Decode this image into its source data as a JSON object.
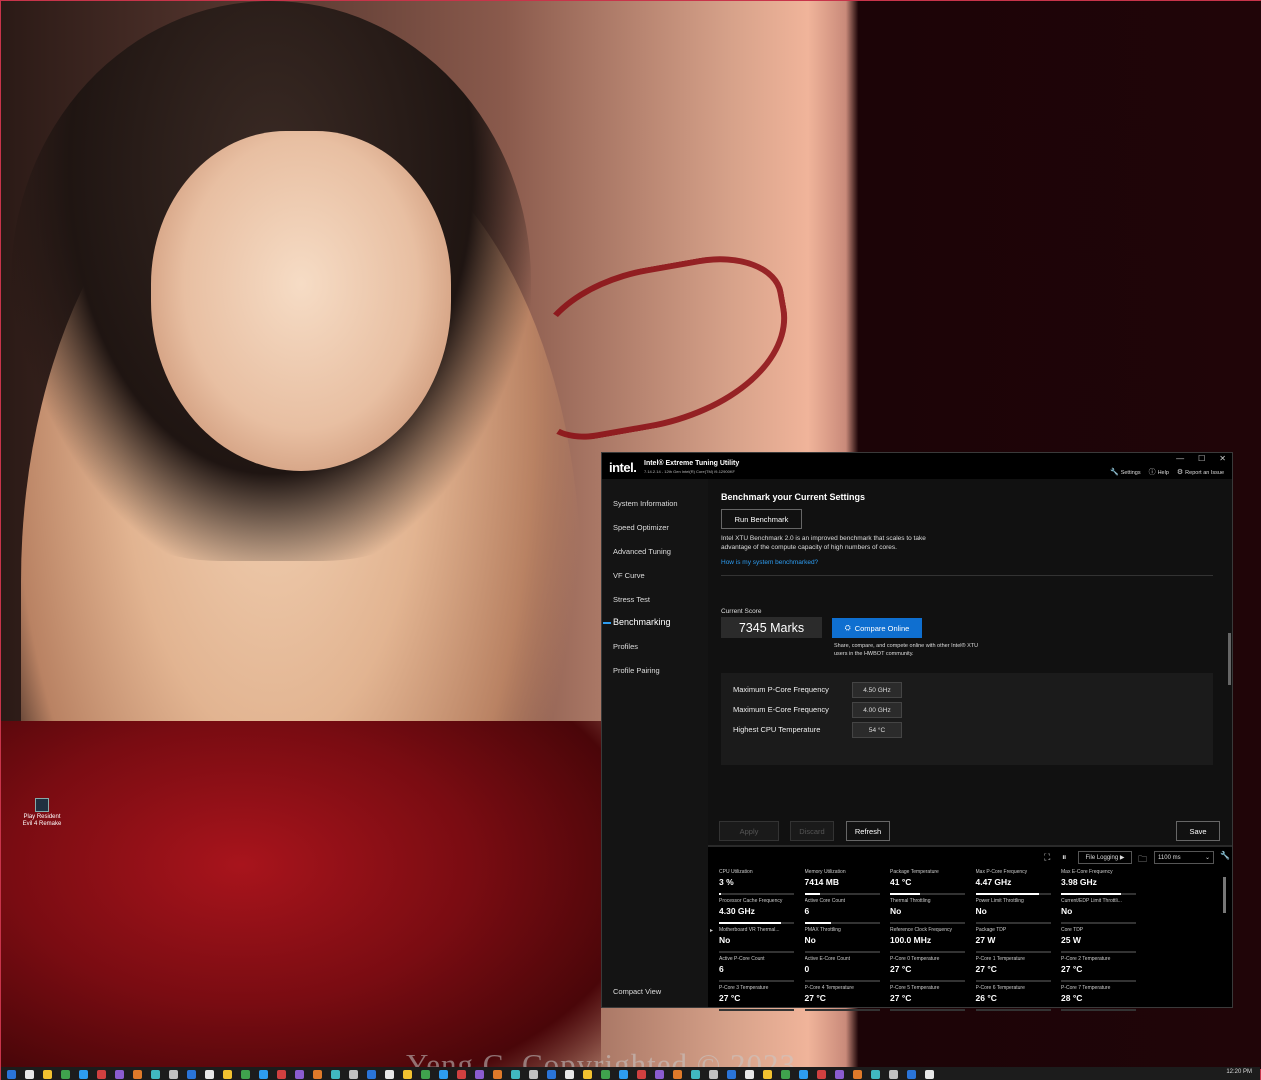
{
  "desktop": {
    "watermark": "Yeng C. Copyrighted © 2023",
    "icon_label": "Play Resident Evil 4 Remake",
    "clock": "12:20 PM"
  },
  "window": {
    "logo": "intel.",
    "title": "Intel® Extreme Tuning Utility",
    "subtitle": "7.14.2.14 - 12th Gen Intel(R) Core(TM) i9-12900KF",
    "controls": {
      "minimize": "—",
      "maximize": "☐",
      "close": "✕"
    },
    "links": {
      "settings": "Settings",
      "help": "Help",
      "report": "Report an Issue"
    }
  },
  "sidebar": {
    "items": [
      {
        "label": "System Information"
      },
      {
        "label": "Speed Optimizer"
      },
      {
        "label": "Advanced Tuning"
      },
      {
        "label": "VF Curve"
      },
      {
        "label": "Stress Test"
      },
      {
        "label": "Benchmarking"
      },
      {
        "label": "Profiles"
      },
      {
        "label": "Profile Pairing"
      }
    ],
    "active_index": 5,
    "compact_view": "Compact View"
  },
  "benchmark": {
    "heading": "Benchmark your Current Settings",
    "run_button": "Run Benchmark",
    "description": "Intel XTU Benchmark 2.0 is an improved benchmark that scales to take advantage of the compute capacity of high numbers of cores.",
    "link": "How is my system benchmarked?",
    "score_label": "Current Score",
    "score": "7345 Marks",
    "compare_button": "Compare Online",
    "compare_note": "Share, compare, and compete online with other Intel® XTU users in the HWBOT community.",
    "stats": [
      {
        "label": "Maximum P-Core Frequency",
        "value": "4.50 GHz"
      },
      {
        "label": "Maximum E-Core Frequency",
        "value": "4.00 GHz"
      },
      {
        "label": "Highest CPU Temperature",
        "value": "54 °C"
      }
    ]
  },
  "actions": {
    "apply": "Apply",
    "discard": "Discard",
    "refresh": "Refresh",
    "save": "Save"
  },
  "monitor": {
    "file_logging": "File Logging ▶",
    "interval": "1100 ms",
    "metrics": [
      {
        "label": "CPU Utilization",
        "value": "3 %",
        "fill": 0.03
      },
      {
        "label": "Memory Utilization",
        "value": "7414  MB",
        "fill": 0.2
      },
      {
        "label": "Package Temperature",
        "value": "41 °C",
        "fill": 0.4
      },
      {
        "label": "Max P-Core Frequency",
        "value": "4.47 GHz",
        "fill": 0.85
      },
      {
        "label": "Max E-Core Frequency",
        "value": "3.98 GHz",
        "fill": 0.8
      },
      {
        "label": "Processor Cache Frequency",
        "value": "4.30 GHz",
        "fill": 0.82
      },
      {
        "label": "Active Core Count",
        "value": "6",
        "fill": 0.35
      },
      {
        "label": "Thermal Throttling",
        "value": "No",
        "fill": 0
      },
      {
        "label": "Power Limit Throttling",
        "value": "No",
        "fill": 0
      },
      {
        "label": "Current/EDP Limit Throttli...",
        "value": "No",
        "fill": 0
      },
      {
        "label": "Motherboard VR Thermal...",
        "value": "No",
        "fill": 0
      },
      {
        "label": "PMAX Throttling",
        "value": "No",
        "fill": 0
      },
      {
        "label": "Reference Clock Frequency",
        "value": "100.0 MHz",
        "fill": 0
      },
      {
        "label": "Package TDP",
        "value": "27 W",
        "fill": 0
      },
      {
        "label": "Core TDP",
        "value": "25 W",
        "fill": 0
      },
      {
        "label": "Active P-Core Count",
        "value": "6",
        "fill": 0
      },
      {
        "label": "Active E-Core Count",
        "value": "0",
        "fill": 0
      },
      {
        "label": "P-Core 0 Temperature",
        "value": "27 °C",
        "fill": 0
      },
      {
        "label": "P-Core 1 Temperature",
        "value": "27 °C",
        "fill": 0
      },
      {
        "label": "P-Core 2 Temperature",
        "value": "27 °C",
        "fill": 0
      },
      {
        "label": "P-Core 3 Temperature",
        "value": "27 °C",
        "fill": 0
      },
      {
        "label": "P-Core 4 Temperature",
        "value": "27 °C",
        "fill": 0
      },
      {
        "label": "P-Core 5 Temperature",
        "value": "27 °C",
        "fill": 0
      },
      {
        "label": "P-Core 6 Temperature",
        "value": "26 °C",
        "fill": 0
      },
      {
        "label": "P-Core 7 Temperature",
        "value": "28 °C",
        "fill": 0
      }
    ]
  },
  "colors": {
    "accent": "#2d9cf0",
    "compare_button": "#0f6fd0",
    "desktop_frame": "#c8344a"
  }
}
